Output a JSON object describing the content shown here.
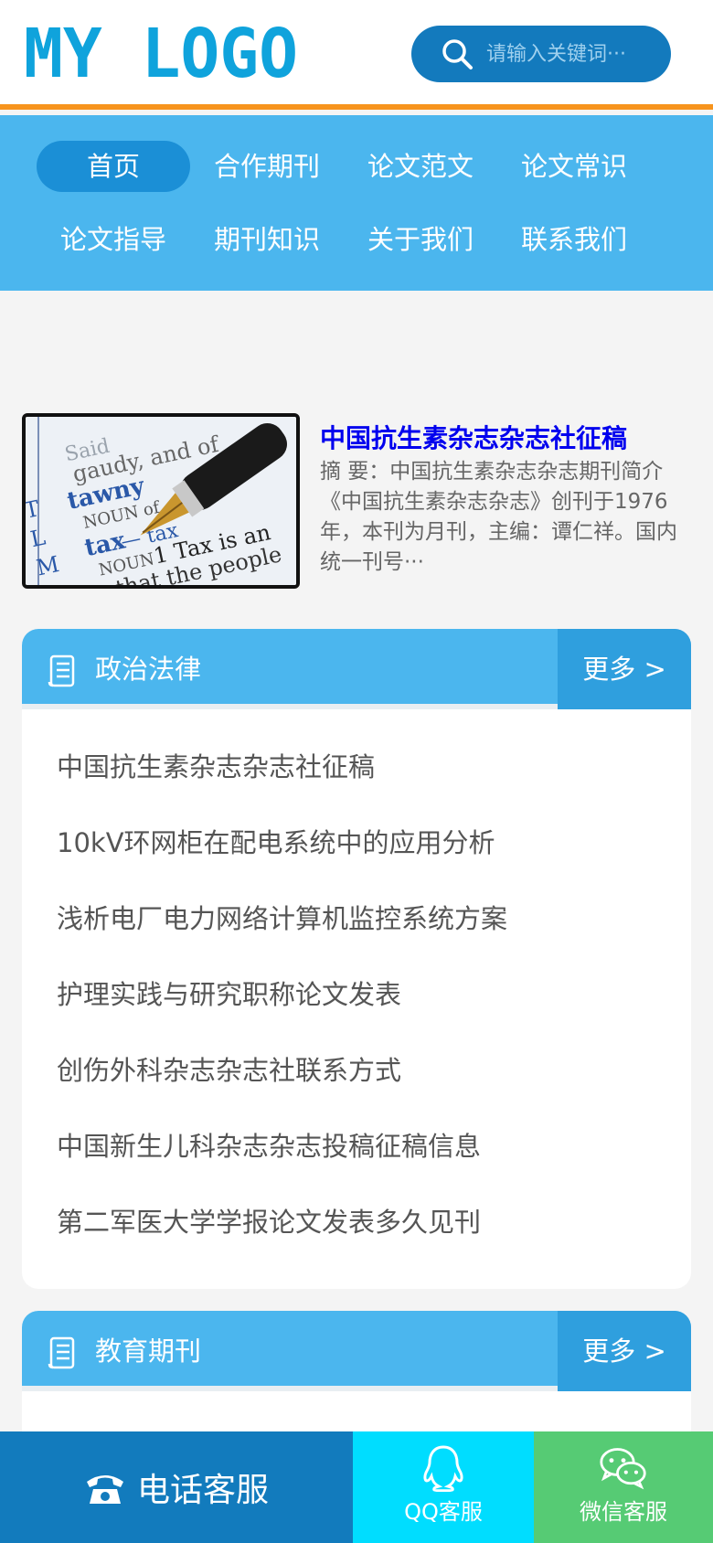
{
  "header": {
    "logo_text": "MY LOGO",
    "search_placeholder": "请输入关键词···"
  },
  "nav": {
    "items": [
      "首页",
      "合作期刊",
      "论文范文",
      "论文常识",
      "论文指导",
      "期刊知识",
      "关于我们",
      "联系我们"
    ],
    "active_index": 0
  },
  "featured": {
    "title": "中国抗生素杂志杂志社征稿",
    "summary": "摘 要：中国抗生素杂志杂志期刊简介《中国抗生素杂志杂志》创刊于1976年，本刊为月刊，主编：谭仁祥。国内统一刊号···"
  },
  "sections": [
    {
      "title": "政治法律",
      "more": "更多 >",
      "items": [
        "中国抗生素杂志杂志社征稿",
        "10kV环网柜在配电系统中的应用分析",
        "浅析电厂电力网络计算机监控系统方案",
        "护理实践与研究职称论文发表",
        "创伤外科杂志杂志社联系方式",
        "中国新生儿科杂志杂志投稿征稿信息",
        "第二军医大学学报论文发表多久见刊"
      ]
    },
    {
      "title": "教育期刊",
      "more": "更多 >",
      "items": []
    }
  ],
  "bottom_bar": {
    "phone_label": "电话客服",
    "qq_label": "QQ客服",
    "wechat_label": "微信客服"
  },
  "colors": {
    "accent_blue": "#4bb6ee",
    "dark_blue": "#137abd",
    "orange": "#f7941d",
    "qq_cyan": "#00ddff",
    "wechat_green": "#56cb74",
    "link_blue": "#0000ee"
  }
}
